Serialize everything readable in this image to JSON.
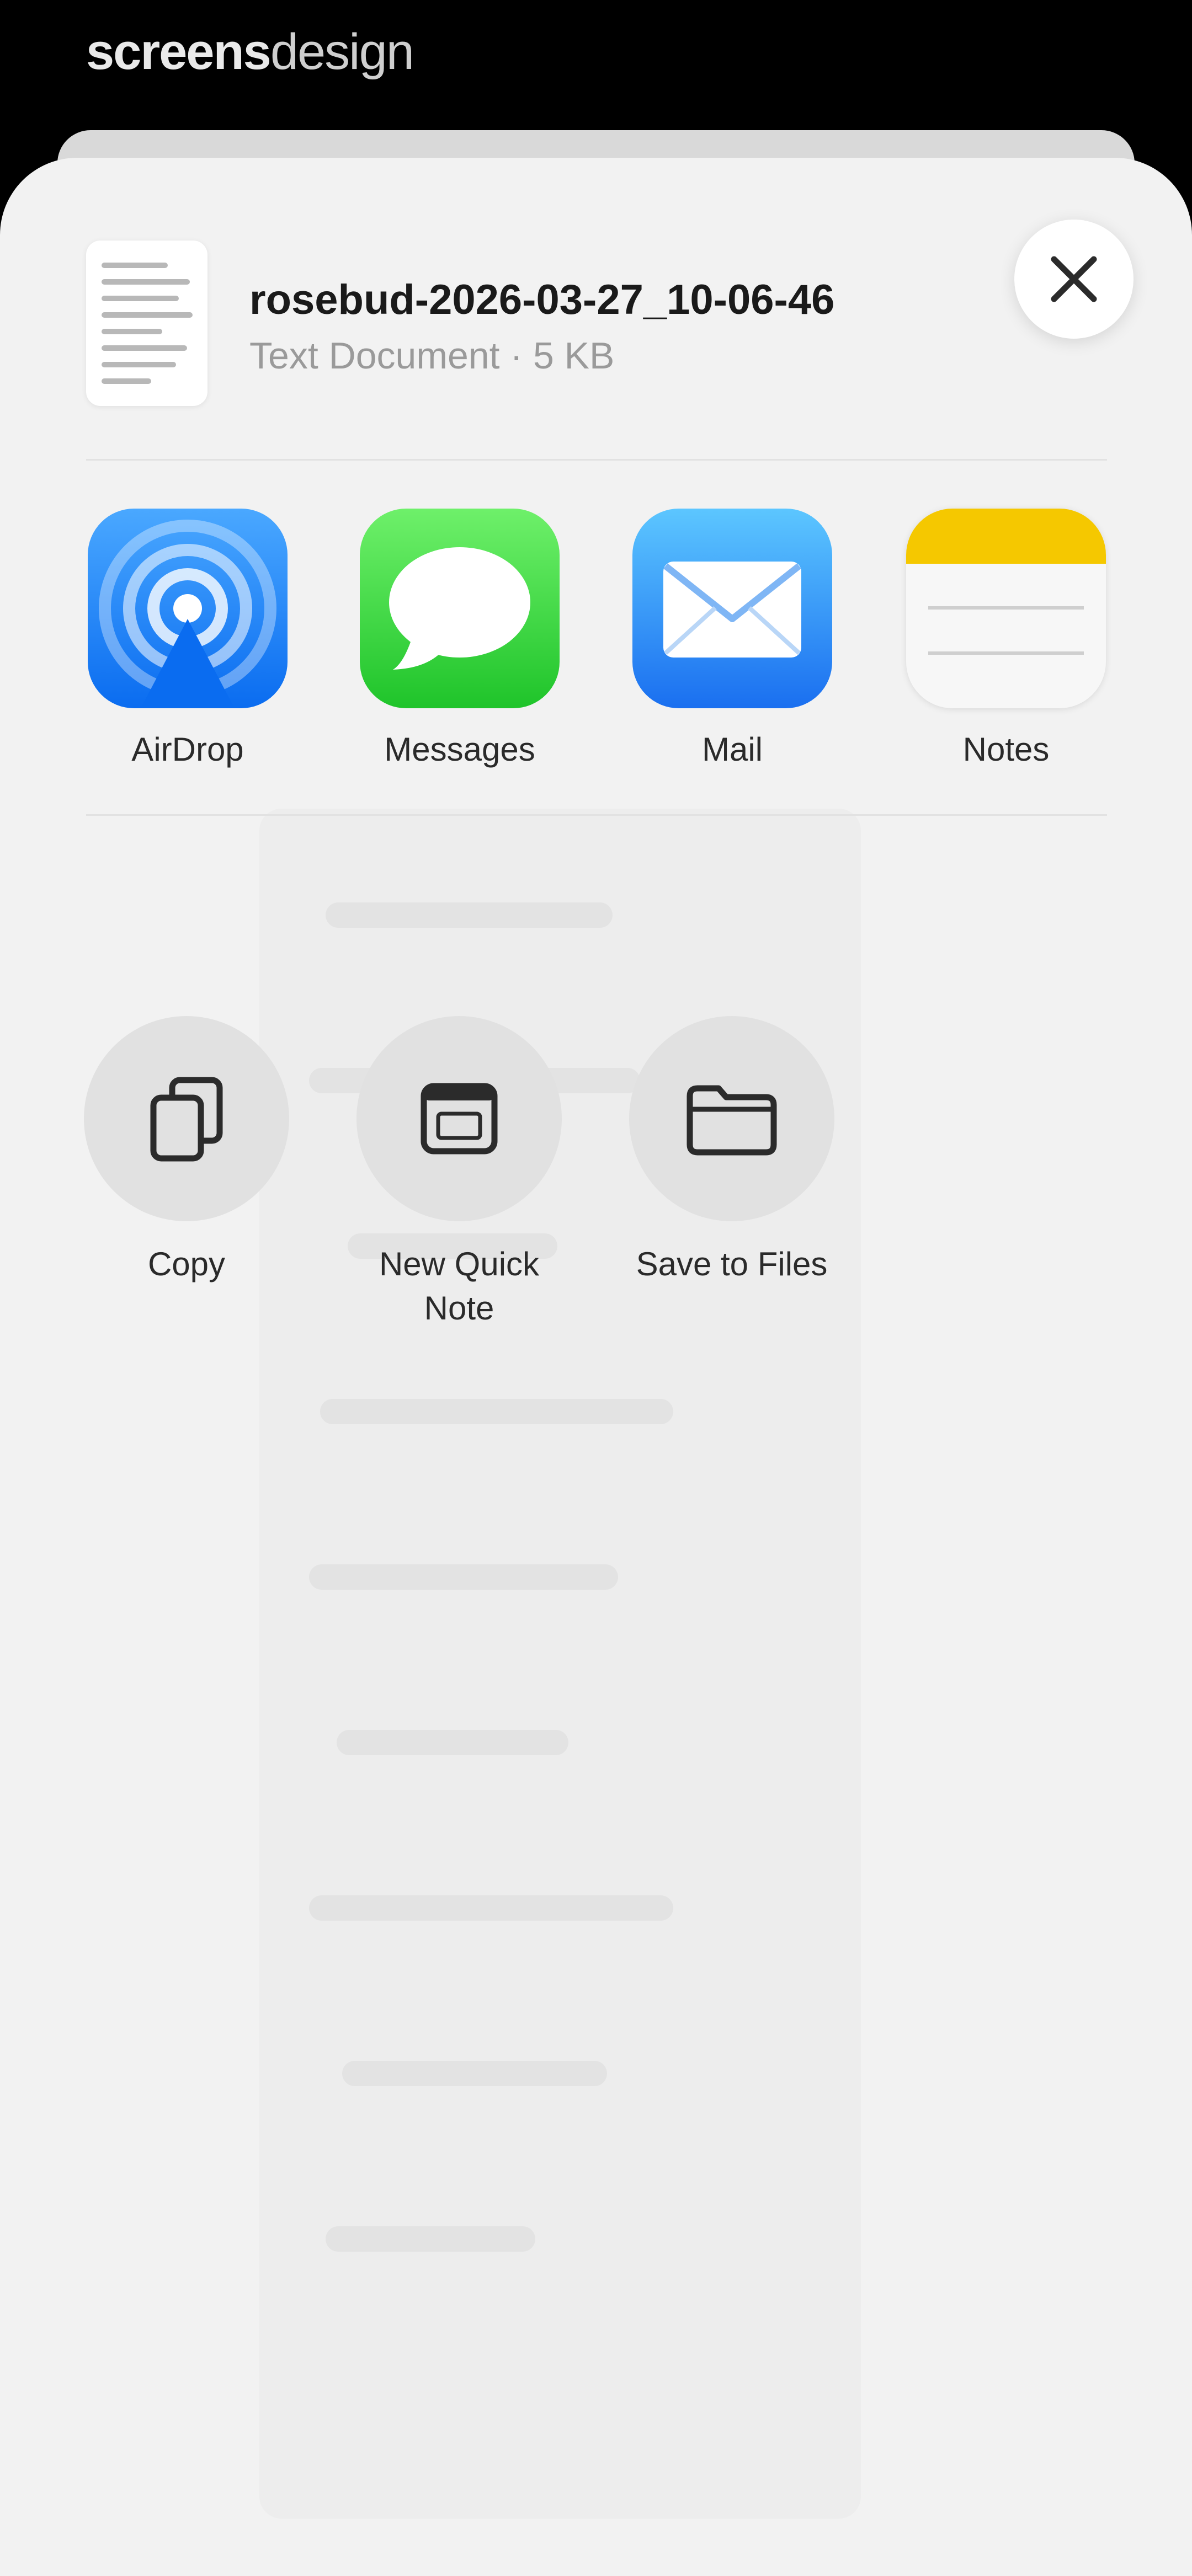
{
  "watermark": {
    "bold": "screens",
    "light": "design"
  },
  "file": {
    "name": "rosebud-2026-03-27_10-06-46",
    "subtitle": "Text Document · 5 KB"
  },
  "apps": [
    {
      "label": "AirDrop",
      "icon": "airdrop-icon"
    },
    {
      "label": "Messages",
      "icon": "messages-icon"
    },
    {
      "label": "Mail",
      "icon": "mail-icon"
    },
    {
      "label": "Notes",
      "icon": "notes-icon"
    }
  ],
  "actions": [
    {
      "label": "Copy",
      "icon": "copy-icon"
    },
    {
      "label": "New Quick Note",
      "icon": "quick-note-icon"
    },
    {
      "label": "Save to Files",
      "icon": "folder-icon"
    }
  ],
  "colors": {
    "sheet_bg": "#f2f2f2",
    "airdrop": "#0a6cf0",
    "messages": "#1fc42a",
    "mail": "#1a6ff0",
    "notes_accent": "#f5c800"
  }
}
